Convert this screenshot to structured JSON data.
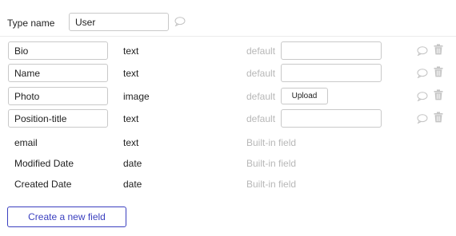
{
  "type": {
    "label": "Type name",
    "value": "User",
    "comment_icon": "comment-icon"
  },
  "fields": [
    {
      "name": "Bio",
      "type": "text",
      "default_label": "default",
      "kind": "text-input"
    },
    {
      "name": "Name",
      "type": "text",
      "default_label": "default",
      "kind": "text-input"
    },
    {
      "name": "Photo",
      "type": "image",
      "default_label": "default",
      "kind": "upload",
      "upload_label": "Upload"
    },
    {
      "name": "Position-title",
      "type": "text",
      "default_label": "default",
      "kind": "text-input"
    }
  ],
  "builtin_fields": [
    {
      "name": "email",
      "type": "text",
      "note": "Built-in field"
    },
    {
      "name": "Modified Date",
      "type": "date",
      "note": "Built-in field"
    },
    {
      "name": "Created Date",
      "type": "date",
      "note": "Built-in field"
    }
  ],
  "actions": {
    "create_label": "Create a new field"
  },
  "icons": {
    "comment": "comment-icon",
    "delete": "trash-icon"
  },
  "colors": {
    "accent": "#3a3fbf",
    "muted_text": "#b8b8b8",
    "icon": "#c4c4c4",
    "border": "#c9c9c9"
  }
}
